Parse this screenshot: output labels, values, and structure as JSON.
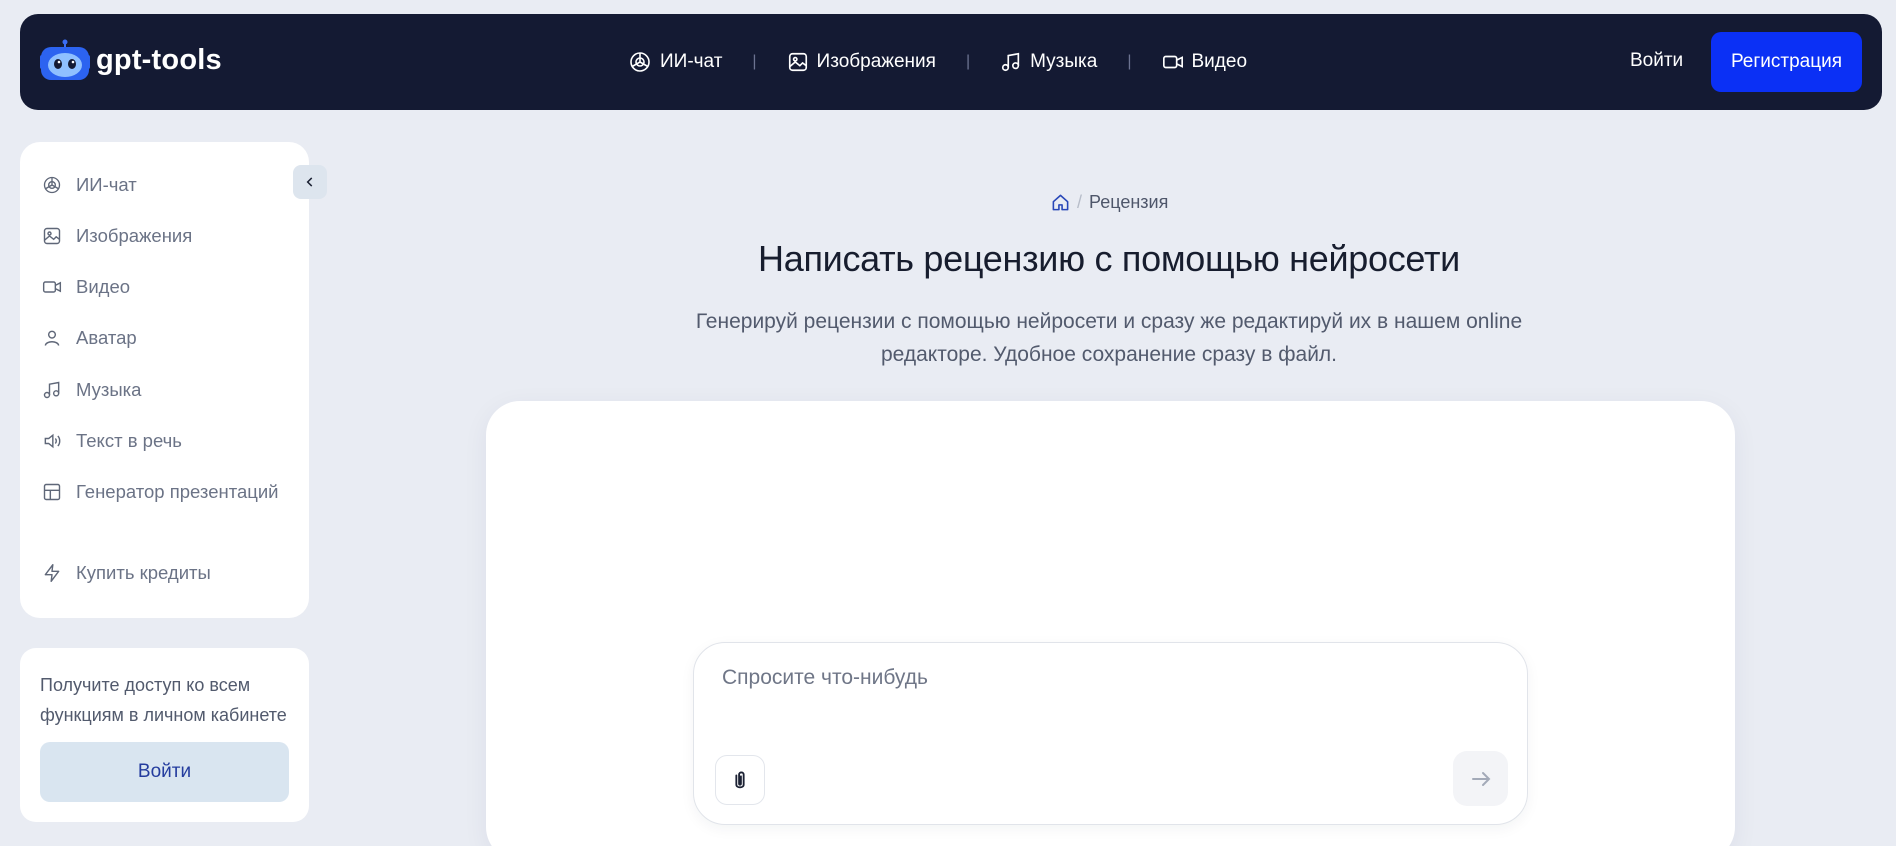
{
  "header": {
    "logo_text": "gpt-tools",
    "nav": [
      {
        "label": "ИИ-чат",
        "icon": "openai-icon"
      },
      {
        "label": "Изображения",
        "icon": "image-icon"
      },
      {
        "label": "Музыка",
        "icon": "music-icon"
      },
      {
        "label": "Видео",
        "icon": "video-icon"
      }
    ],
    "separator": "|",
    "login_label": "Войти",
    "register_label": "Регистрация"
  },
  "sidebar": {
    "items": [
      {
        "label": "ИИ-чат",
        "icon": "openai-icon"
      },
      {
        "label": "Изображения",
        "icon": "image-icon"
      },
      {
        "label": "Видео",
        "icon": "video-icon"
      },
      {
        "label": "Аватар",
        "icon": "user-icon"
      },
      {
        "label": "Музыка",
        "icon": "music-icon"
      },
      {
        "label": "Текст в речь",
        "icon": "speaker-icon"
      },
      {
        "label": "Генератор презентаций",
        "icon": "layout-icon"
      }
    ],
    "buy_credits": {
      "label": "Купить кредиты",
      "icon": "lightning-icon"
    },
    "collapse_icon": "chevron-left-icon"
  },
  "promo": {
    "text": "Получите доступ ко всем функциям в личном кабинете",
    "button_label": "Войти"
  },
  "breadcrumb": {
    "home_icon": "home-icon",
    "separator": "/",
    "current": "Рецензия"
  },
  "main": {
    "title": "Написать рецензию с помощью нейросети",
    "description": "Генерируй рецензии с помощью нейросети и сразу же редактируй их в нашем online редакторе. Удобное сохранение сразу в файл."
  },
  "prompt": {
    "placeholder": "Спросите что-нибудь",
    "value": "",
    "attach_icon": "paperclip-icon",
    "send_icon": "arrow-right-icon"
  },
  "colors": {
    "page_bg": "#e9ecf3",
    "header_bg": "#141a33",
    "accent": "#0b30f5",
    "promo_button_bg": "#d9e5f0"
  }
}
